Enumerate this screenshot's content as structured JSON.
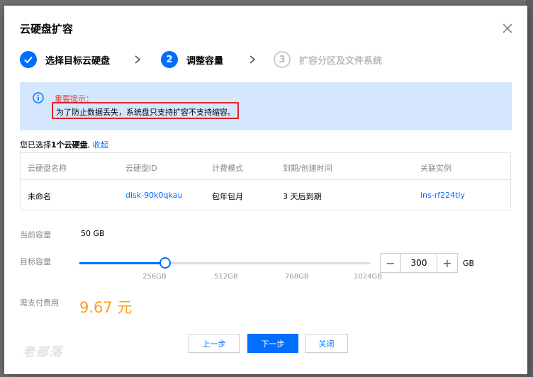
{
  "dialog": {
    "title": "云硬盘扩容"
  },
  "steps": [
    {
      "index": "✓",
      "label": "选择目标云硬盘",
      "state": "done"
    },
    {
      "index": "2",
      "label": "调整容量",
      "state": "active"
    },
    {
      "index": "3",
      "label": "扩容分区及文件系统",
      "state": "pending"
    }
  ],
  "notice": {
    "title": "重要提示：",
    "text": "为了防止数据丢失，系统盘只支持扩容不支持缩容。"
  },
  "selection": {
    "prefix": "您已选择",
    "count_text": "1个云硬盘",
    "separator": ", ",
    "collapse_label": "收起"
  },
  "table": {
    "headers": [
      "云硬盘名称",
      "云硬盘ID",
      "计费模式",
      "到期/创建时间",
      "关联实例"
    ],
    "rows": [
      [
        "未命名",
        "disk-90k0qkau",
        "包年包月",
        "3 天后到期",
        "ins-rf224tly"
      ]
    ]
  },
  "capacity": {
    "current_label": "当前容量",
    "current_value": "50 GB",
    "target_label": "目标容量",
    "target_value": "300",
    "unit": "GB",
    "slider_fraction": 0.294,
    "ticks": [
      "256GB",
      "512GB",
      "768GB",
      "1024GB"
    ]
  },
  "payment": {
    "label": "需支付费用",
    "amount": "9.67 元"
  },
  "buttons": {
    "prev": "上一步",
    "next": "下一步",
    "close": "关闭"
  },
  "watermark": "老部落",
  "colors": {
    "primary": "#006eff",
    "notice_bg": "#d5e7fd",
    "notice_title": "#e54545",
    "highlight_border": "#e0242c",
    "price": "#ff9c19"
  },
  "icons": {
    "close": "close-icon",
    "info": "info-icon",
    "check": "check-icon",
    "arrow": "chevron-right-icon"
  }
}
